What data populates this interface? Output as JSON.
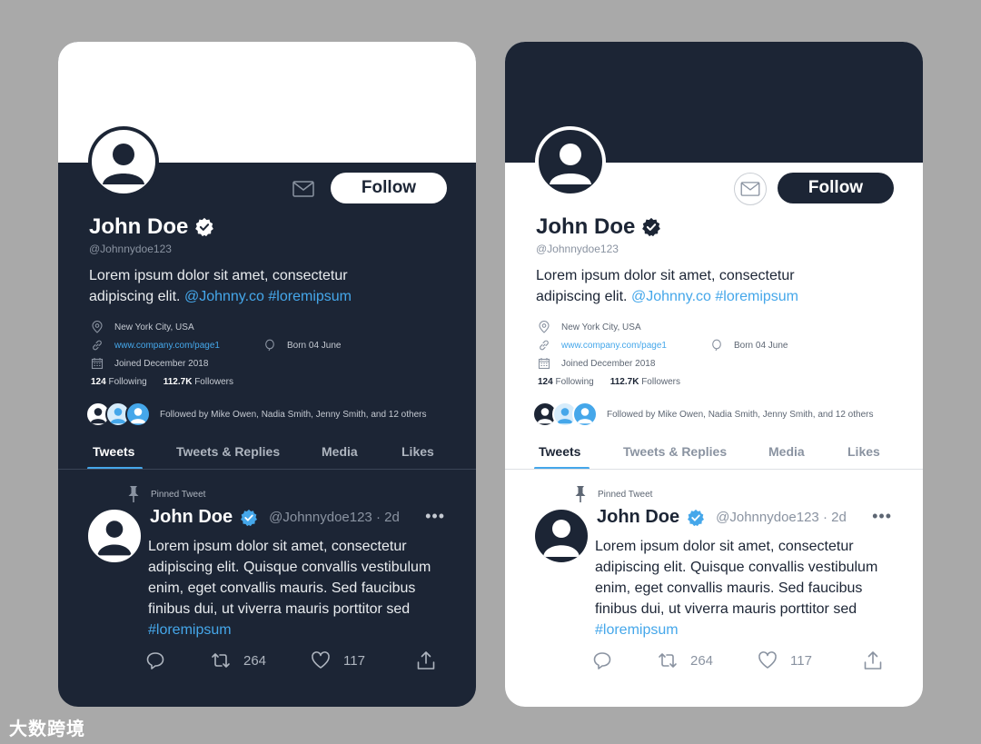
{
  "colors": {
    "navy": "#1c2535",
    "accent": "#45a7ea",
    "verified_light": "#45a7ea",
    "background": "#a9a9a9"
  },
  "cards": [
    {
      "theme": "dark",
      "follow_label": "Follow",
      "name": "John Doe",
      "handle": "@Johnnydoe123",
      "bio_text": "Lorem ipsum dolor sit amet, consectetur adipiscing elit.",
      "bio_mention": "@Johnny.co",
      "bio_hashtag": "#loremipsum",
      "location": "New York City, USA",
      "website": "www.company.com/page1",
      "born": "Born 04 June",
      "joined": "Joined December 2018",
      "following_count": "124",
      "following_label": "Following",
      "followers_count": "112.7K",
      "followers_label": "Followers",
      "followed_by": "Followed by Mike Owen, Nadia Smith, Jenny Smith, and 12 others",
      "tabs": [
        "Tweets",
        "Tweets & Replies",
        "Media",
        "Likes"
      ],
      "pinned_label": "Pinned Tweet",
      "tweet_name": "John Doe",
      "tweet_meta": "@Johnnydoe123 · 2d",
      "tweet_more": "•••",
      "tweet_text": "Lorem ipsum dolor sit amet, consectetur adipiscing elit. Quisque convallis vestibulum enim, eget convallis mauris. Sed faucibus finibus dui, ut viverra mauris porttitor sed",
      "tweet_hashtag": "#loremipsum",
      "retweets": "264",
      "likes": "117",
      "icons": [
        "mail-icon",
        "verified-icon",
        "location-icon",
        "link-icon",
        "balloon-icon",
        "calendar-icon",
        "pin-icon",
        "reply-icon",
        "retweet-icon",
        "heart-icon",
        "share-icon"
      ]
    },
    {
      "theme": "light",
      "follow_label": "Follow",
      "name": "John Doe",
      "handle": "@Johnnydoe123",
      "bio_text": "Lorem ipsum dolor sit amet, consectetur adipiscing elit.",
      "bio_mention": "@Johnny.co",
      "bio_hashtag": "#loremipsum",
      "location": "New York City, USA",
      "website": "www.company.com/page1",
      "born": "Born 04 June",
      "joined": "Joined December 2018",
      "following_count": "124",
      "following_label": "Following",
      "followers_count": "112.7K",
      "followers_label": "Followers",
      "followed_by": "Followed by Mike Owen, Nadia Smith, Jenny Smith, and 12 others",
      "tabs": [
        "Tweets",
        "Tweets & Replies",
        "Media",
        "Likes"
      ],
      "pinned_label": "Pinned Tweet",
      "tweet_name": "John Doe",
      "tweet_meta": "@Johnnydoe123 · 2d",
      "tweet_more": "•••",
      "tweet_text": "Lorem ipsum dolor sit amet, consectetur adipiscing elit. Quisque convallis vestibulum enim, eget convallis mauris. Sed faucibus finibus dui, ut viverra mauris porttitor sed",
      "tweet_hashtag": "#loremipsum",
      "retweets": "264",
      "likes": "117",
      "icons": [
        "mail-icon",
        "verified-icon",
        "location-icon",
        "link-icon",
        "balloon-icon",
        "calendar-icon",
        "pin-icon",
        "reply-icon",
        "retweet-icon",
        "heart-icon",
        "share-icon"
      ]
    }
  ],
  "watermark": "大数跨境"
}
